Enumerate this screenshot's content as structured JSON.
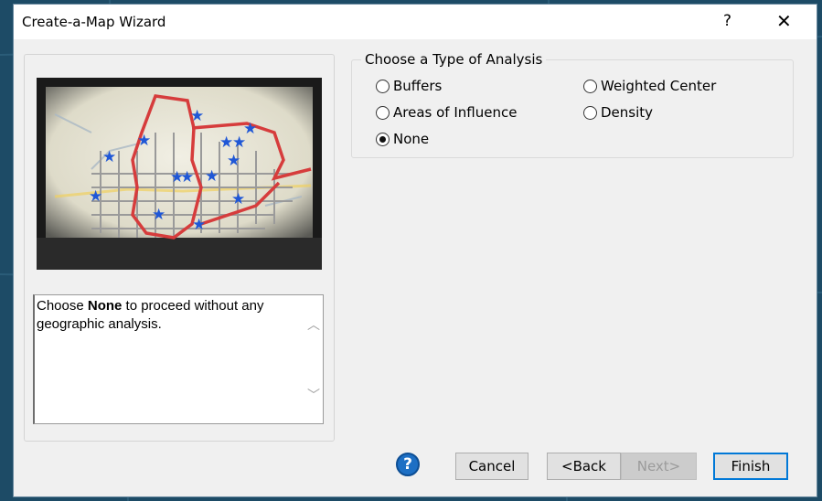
{
  "window": {
    "title": "Create-a-Map Wizard",
    "help_glyph": "?",
    "close_glyph": "✕"
  },
  "description": {
    "prefix": "Choose ",
    "bold": "None",
    "suffix": " to proceed without any geographic analysis."
  },
  "analysis": {
    "legend": "Choose a Type of Analysis",
    "options": [
      {
        "label": "Buffers",
        "selected": false
      },
      {
        "label": "Weighted Center",
        "selected": false
      },
      {
        "label": "Areas of Influence",
        "selected": false
      },
      {
        "label": "Density",
        "selected": false
      },
      {
        "label": "None",
        "selected": true
      }
    ]
  },
  "buttons": {
    "help_icon": "?",
    "cancel": "Cancel",
    "back": "<Back",
    "next": "Next>",
    "finish": "Finish"
  },
  "icons": {
    "help": "help-icon",
    "close": "close-icon",
    "scroll_up": "chevron-up-icon",
    "scroll_down": "chevron-down-icon"
  },
  "colors": {
    "accent": "#0078d7",
    "dialog_bg": "#f0f0f0",
    "map_route": "#d63c3c",
    "map_star": "#1f57d6"
  }
}
